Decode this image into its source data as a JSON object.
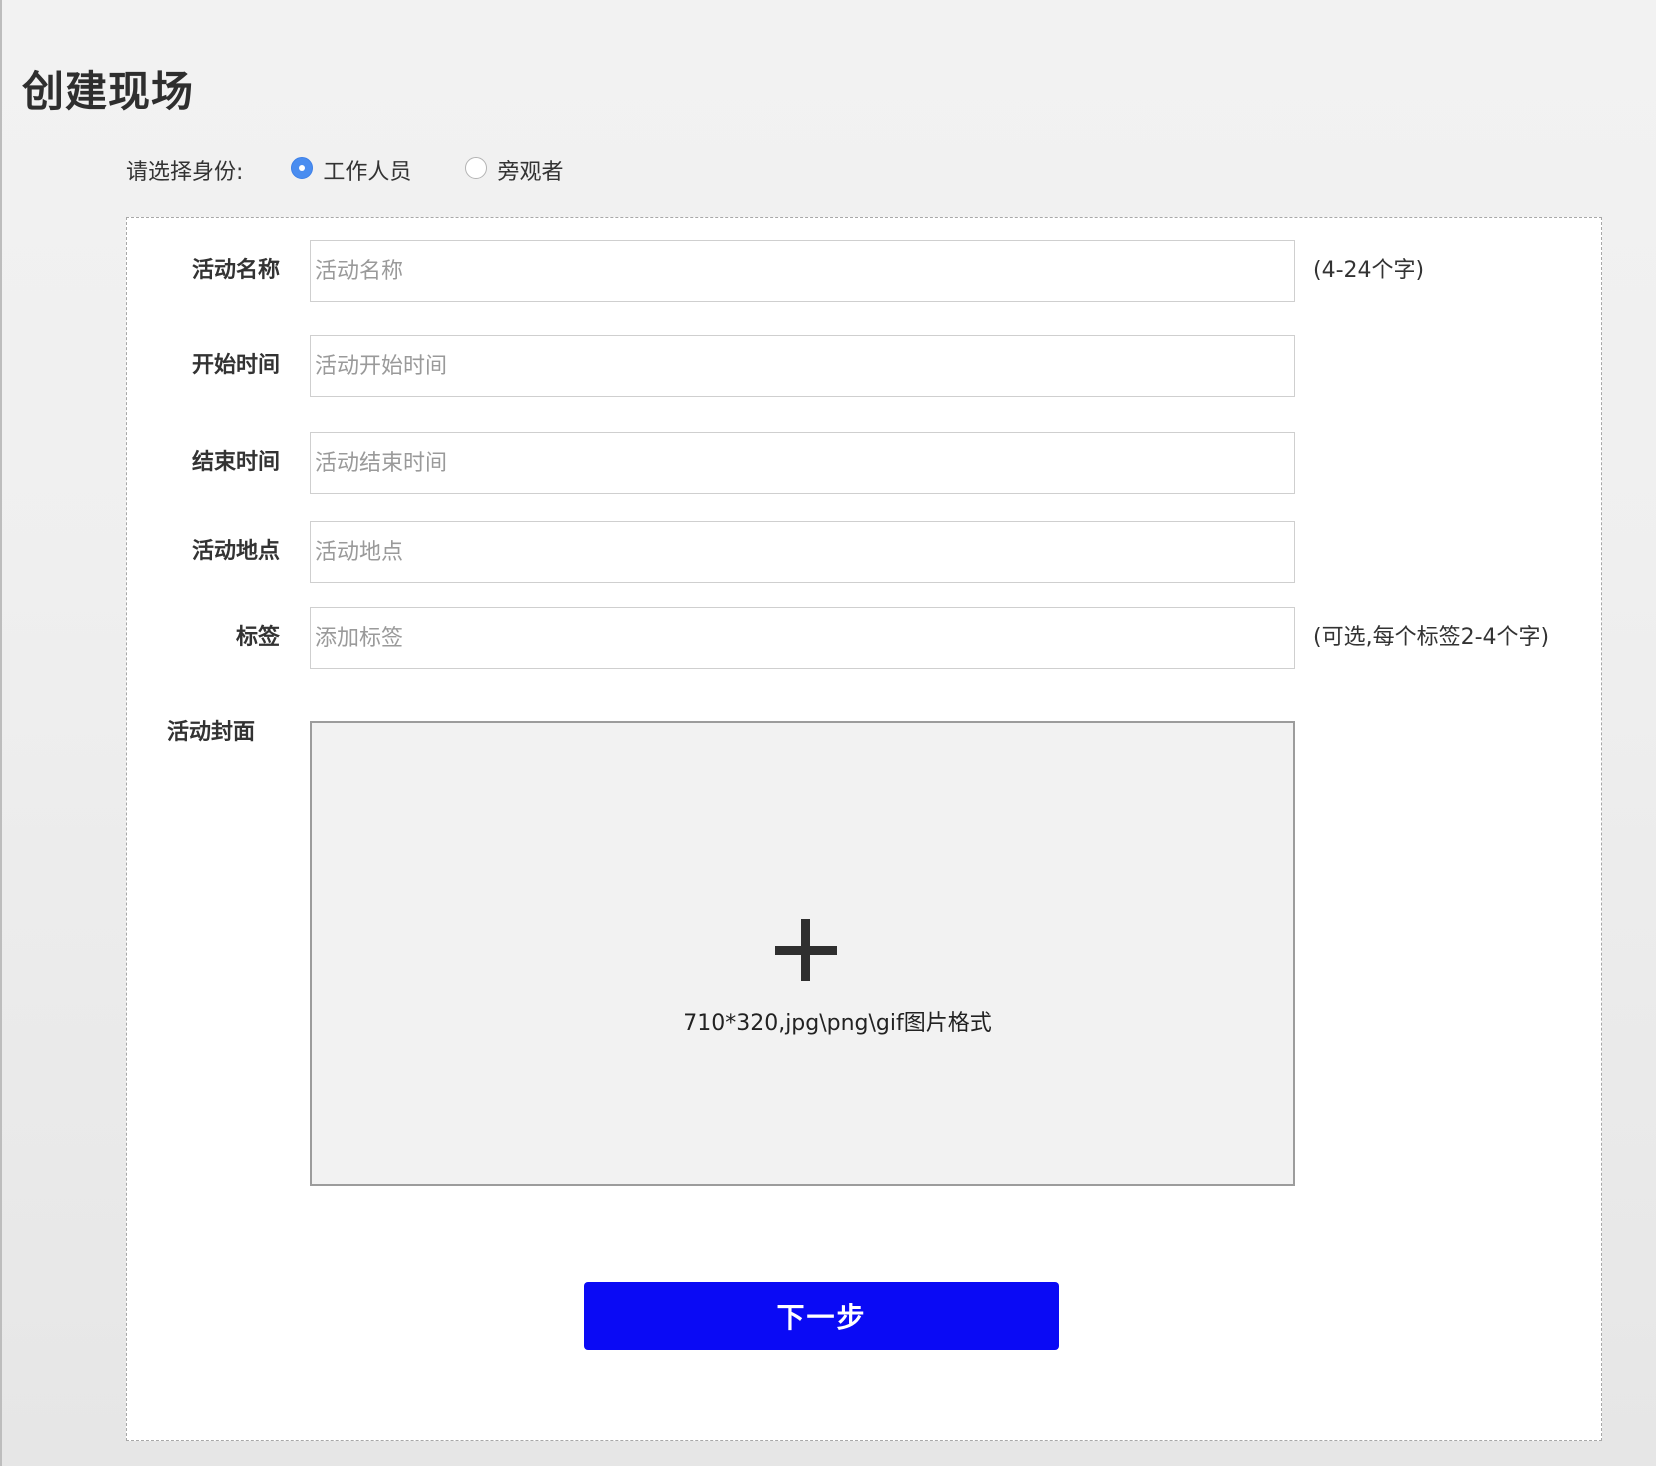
{
  "page": {
    "title": "创建现场"
  },
  "identity": {
    "label": "请选择身份:",
    "options": [
      {
        "label": "工作人员",
        "checked": true
      },
      {
        "label": "旁观者",
        "checked": false
      }
    ]
  },
  "form": {
    "fields": [
      {
        "label": "活动名称",
        "placeholder": "活动名称",
        "value": "",
        "hint": "(4-24个字)"
      },
      {
        "label": "开始时间",
        "placeholder": "活动开始时间",
        "value": "",
        "hint": ""
      },
      {
        "label": "结束时间",
        "placeholder": "活动结束时间",
        "value": "",
        "hint": ""
      },
      {
        "label": "活动地点",
        "placeholder": "活动地点",
        "value": "",
        "hint": ""
      },
      {
        "label": "标签",
        "placeholder": "添加标签",
        "value": "",
        "hint": "(可选,每个标签2-4个字)"
      }
    ],
    "cover": {
      "label": "活动封面",
      "icon": "plus-icon",
      "hint": "710*320,jpg\\png\\gif图片格式"
    },
    "next_label": "下一步"
  },
  "colors": {
    "accent_blue": "#0a0af5",
    "radio_checked": "#4a8df0",
    "cover_background": "#f2f2f2"
  }
}
